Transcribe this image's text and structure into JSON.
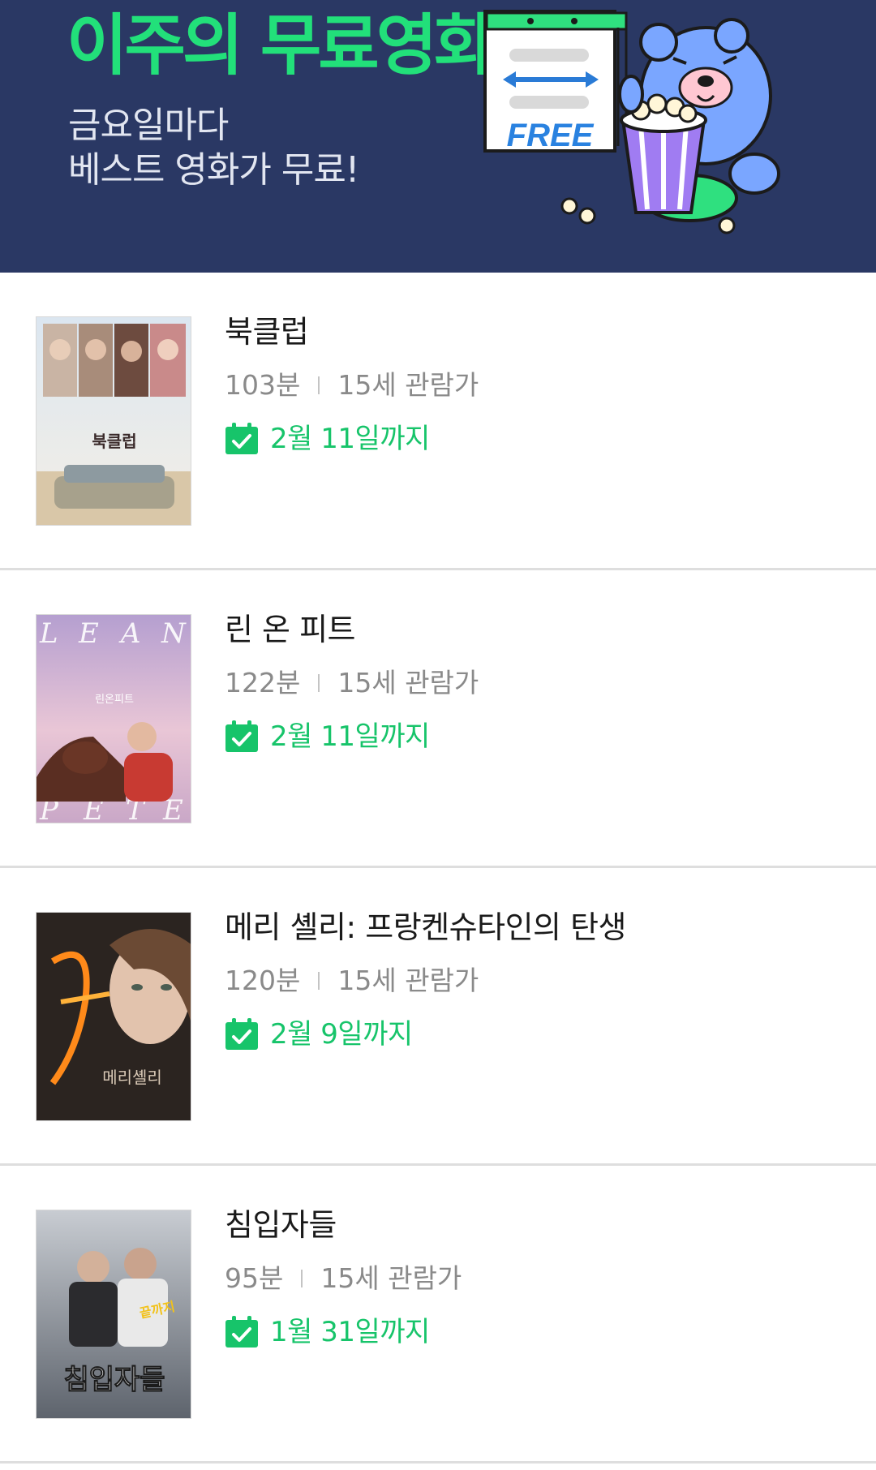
{
  "banner": {
    "title": "이주의 무료영화",
    "subtitle_line1": "금요일마다",
    "subtitle_line2": "베스트 영화가 무료!",
    "badge": "FREE",
    "accent_color": "#22e07a",
    "background_color": "#2a3864"
  },
  "movies": [
    {
      "title": "북클럽",
      "runtime": "103분",
      "rating": "15세 관람가",
      "deadline": "2월 11일까지",
      "poster_text": "북클럽",
      "poster_icon": "bookclub-poster"
    },
    {
      "title": "린 온 피트",
      "runtime": "122분",
      "rating": "15세 관람가",
      "deadline": "2월 11일까지",
      "poster_text": "린온피트",
      "poster_icon": "lean-on-pete-poster"
    },
    {
      "title": "메리 셸리: 프랑켄슈타인의 탄생",
      "runtime": "120분",
      "rating": "15세 관람가",
      "deadline": "2월 9일까지",
      "poster_text": "메리셸리",
      "poster_icon": "mary-shelley-poster"
    },
    {
      "title": "침입자들",
      "runtime": "95분",
      "rating": "15세 관람가",
      "deadline": "1월 31일까지",
      "poster_text": "침입자들",
      "poster_icon": "intruders-poster"
    }
  ],
  "icons": {
    "deadline": "calendar-check-icon"
  },
  "colors": {
    "deadline_text": "#17c46a",
    "meta_text": "#8a8a8a",
    "divider": "#dedede"
  }
}
